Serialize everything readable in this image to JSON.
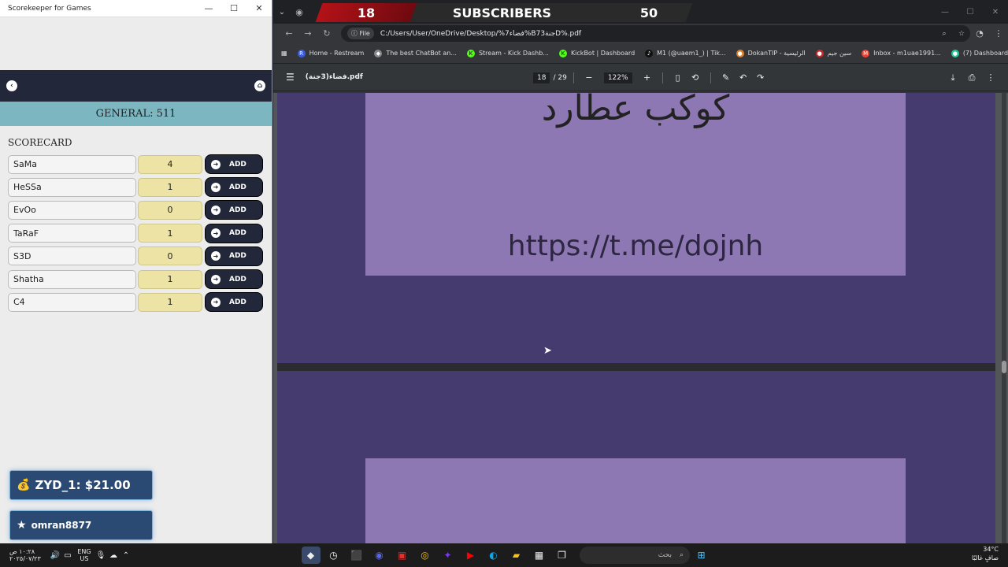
{
  "scorekeeper": {
    "window_title": "Scorekeeper for Games",
    "general": "GENERAL: 511",
    "scorecard_title": "SCORECARD",
    "add_label": "ADD",
    "players": [
      {
        "name": "SaMa",
        "score": "4"
      },
      {
        "name": "HeSSa",
        "score": "1"
      },
      {
        "name": "EvOo",
        "score": "0"
      },
      {
        "name": "TaRaF",
        "score": "1"
      },
      {
        "name": "S3D",
        "score": "0"
      },
      {
        "name": "Shatha",
        "score": "1"
      },
      {
        "name": "C4",
        "score": "1"
      }
    ]
  },
  "overlay": {
    "donation": "ZYD_1: $21.00",
    "follower": "omran8877"
  },
  "subscribers": {
    "current": "18",
    "label": "SUBSCRIBERS",
    "goal": "50"
  },
  "browser": {
    "file_chip": "File",
    "url": "C:/Users/User/OneDrive/Desktop/%7فضاء%B7جنة3D%.pdf",
    "bookmarks": [
      {
        "label": "Home - Restream",
        "color": "#3b5bdb"
      },
      {
        "label": "The best ChatBot an...",
        "color": "#888888"
      },
      {
        "label": "Stream - Kick Dashb...",
        "color": "#53fc18"
      },
      {
        "label": "KickBot | Dashboard",
        "color": "#53fc18"
      },
      {
        "label": "M1 (@uaem1_) | Tik...",
        "color": "#111111"
      },
      {
        "label": "DokanTIP - الرئيسية",
        "color": "#d9822b"
      },
      {
        "label": "سين جيم",
        "color": "#c92a2a"
      },
      {
        "label": "Inbox - m1uae1991...",
        "color": "#ea4335"
      },
      {
        "label": "(7) Dashboard / Stre...",
        "color": "#20c997"
      }
    ]
  },
  "pdf": {
    "filename": "فضاء(3جنة).pdf",
    "page_current": "18",
    "page_total": "/ 29",
    "zoom": "122%",
    "page_heading": "كوكب عطارد",
    "page_link": "https://t.me/dojnh"
  },
  "taskbar": {
    "time": "١٠:٢٨ ص",
    "date": "٢٠٢٥/٠٧/٢٣",
    "lang_line1": "ENG",
    "lang_line2": "US",
    "search_placeholder": "بحث",
    "temperature": "34°C",
    "weather": "صافٍ غالبًا"
  }
}
